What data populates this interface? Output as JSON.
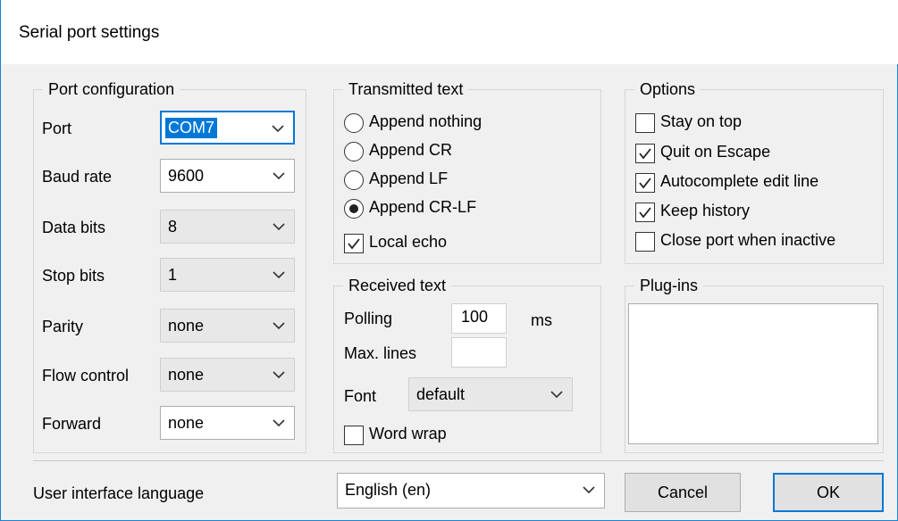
{
  "window": {
    "title": "Serial port settings"
  },
  "port_config": {
    "legend": "Port configuration",
    "port": {
      "label": "Port",
      "value": "COM7"
    },
    "baud_rate": {
      "label": "Baud rate",
      "value": "9600"
    },
    "data_bits": {
      "label": "Data bits",
      "value": "8"
    },
    "stop_bits": {
      "label": "Stop bits",
      "value": "1"
    },
    "parity": {
      "label": "Parity",
      "value": "none"
    },
    "flow_control": {
      "label": "Flow control",
      "value": "none"
    },
    "forward": {
      "label": "Forward",
      "value": "none"
    }
  },
  "transmitted": {
    "legend": "Transmitted text",
    "options": [
      "Append nothing",
      "Append CR",
      "Append LF",
      "Append CR-LF"
    ],
    "selected": "Append CR-LF",
    "local_echo": {
      "label": "Local echo",
      "checked": true
    }
  },
  "received": {
    "legend": "Received text",
    "polling_label": "Polling",
    "polling_value": "100",
    "polling_unit": "ms",
    "max_lines_label": "Max. lines",
    "max_lines_value": "",
    "font_label": "Font",
    "font_value": "default",
    "word_wrap": {
      "label": "Word wrap",
      "checked": false
    }
  },
  "options": {
    "legend": "Options",
    "stay_on_top": {
      "label": "Stay on top",
      "checked": false
    },
    "quit_on_escape": {
      "label": "Quit on Escape",
      "checked": true
    },
    "autocomplete": {
      "label": "Autocomplete edit line",
      "checked": true
    },
    "keep_history": {
      "label": "Keep history",
      "checked": true
    },
    "close_port": {
      "label": "Close port when inactive",
      "checked": false
    }
  },
  "plugins": {
    "legend": "Plug-ins"
  },
  "footer": {
    "language_label": "User interface language",
    "language_value": "English (en)",
    "cancel_label": "Cancel",
    "ok_label": "OK"
  },
  "colors": {
    "accent": "#0078d7",
    "dialog_bg": "#f0f0f0",
    "border": "#1883d7"
  }
}
